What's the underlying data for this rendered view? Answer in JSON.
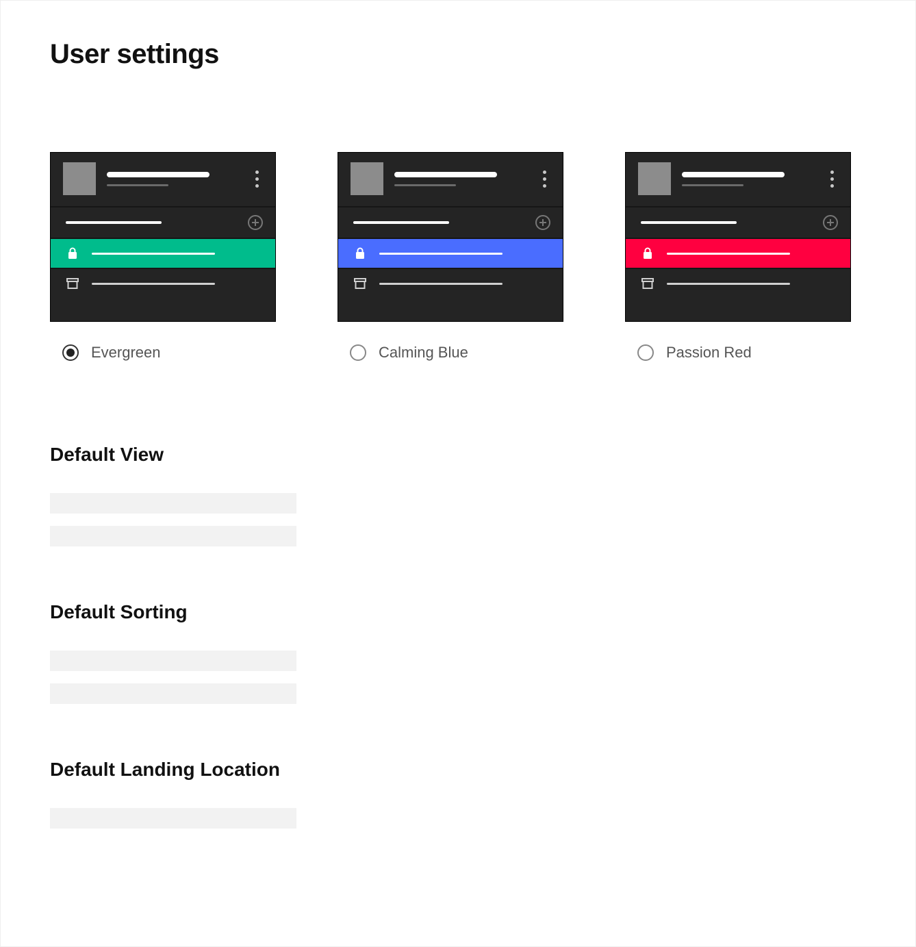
{
  "page": {
    "title": "User settings"
  },
  "themes": [
    {
      "id": "evergreen",
      "label": "Evergreen",
      "accent": "#00bc8c",
      "selected": true
    },
    {
      "id": "calmingblue",
      "label": "Calming Blue",
      "accent": "#4a6dff",
      "selected": false
    },
    {
      "id": "passionred",
      "label": "Passion Red",
      "accent": "#ff0040",
      "selected": false
    }
  ],
  "sections": {
    "defaultView": {
      "title": "Default View"
    },
    "defaultSorting": {
      "title": "Default Sorting"
    },
    "defaultLanding": {
      "title": "Default Landing Location"
    }
  }
}
